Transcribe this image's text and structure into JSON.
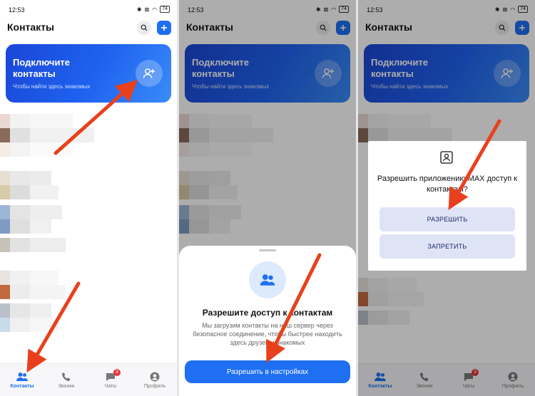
{
  "status": {
    "time": "12:53",
    "battery": "74"
  },
  "header": {
    "title": "Контакты"
  },
  "banner": {
    "title_line1": "Подключите",
    "title_line2": "контакты",
    "subtitle": "Чтобы найти здесь знакомых"
  },
  "tabs": [
    {
      "label": "Контакты"
    },
    {
      "label": "Звонки"
    },
    {
      "label": "Чаты",
      "badge": "3"
    },
    {
      "label": "Профиль"
    }
  ],
  "sheet": {
    "title": "Разрешите доступ к контактам",
    "description": "Мы загрузим контакты на наш сервер через безопасное соединение, чтобы быстрее находить здесь друзей и знакомых",
    "button": "Разрешить в настройках"
  },
  "dialog": {
    "title": "Разрешить приложению MAX доступ к контактам?",
    "allow": "РАЗРЕШИТЬ",
    "deny": "ЗАПРЕТИТЬ"
  },
  "colors": {
    "accent": "#1e6ff2",
    "arrow": "#e8401c",
    "badge": "#e5343f"
  }
}
